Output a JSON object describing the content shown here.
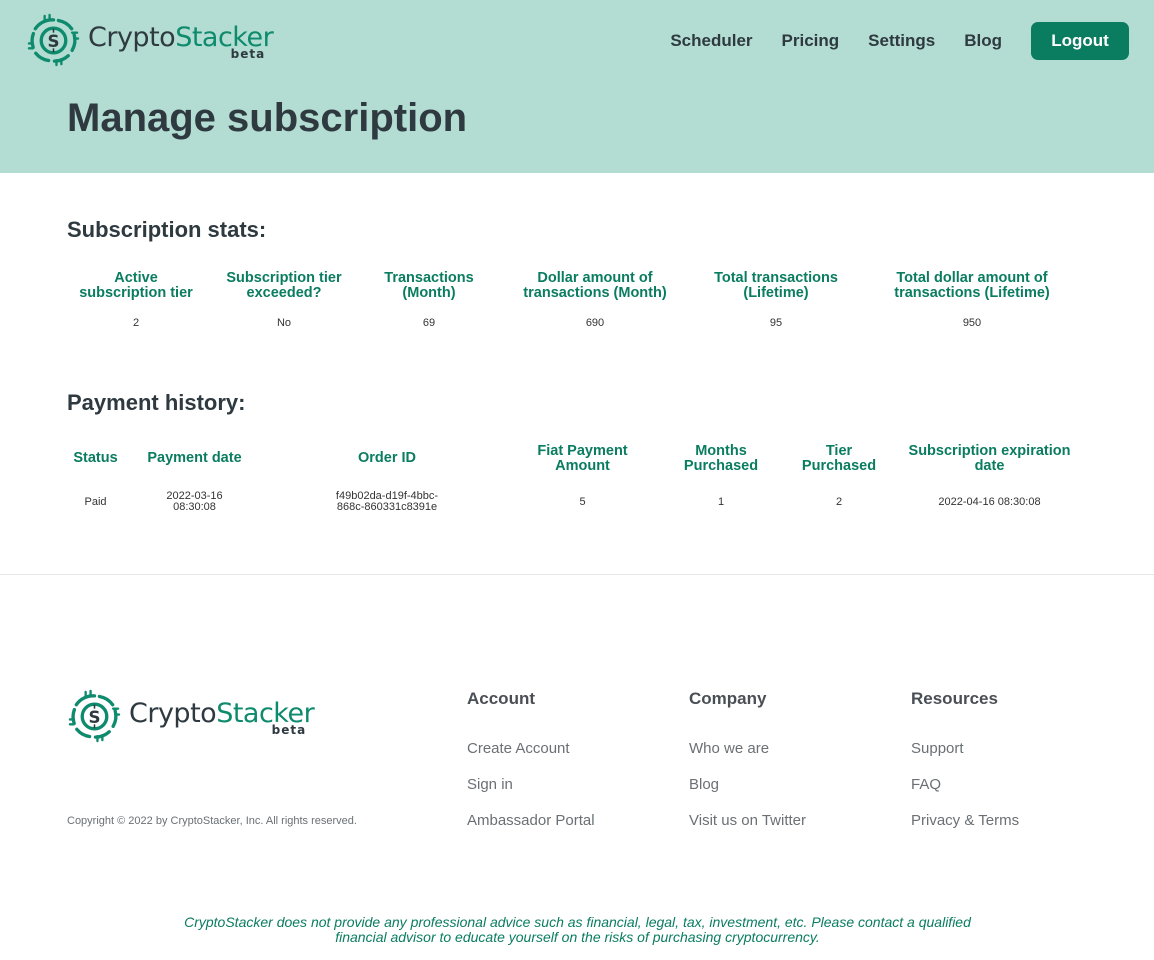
{
  "brand": {
    "name_part1": "Crypto",
    "name_part2": "Stacker",
    "badge": "beta",
    "logo_color": "#0e8a6d"
  },
  "nav": {
    "items": [
      "Scheduler",
      "Pricing",
      "Settings",
      "Blog"
    ],
    "logout_label": "Logout"
  },
  "page": {
    "title": "Manage subscription"
  },
  "stats": {
    "heading": "Subscription stats:",
    "columns": [
      [
        "Active",
        "subscription tier"
      ],
      [
        "Subscription tier",
        "exceeded?"
      ],
      [
        "Transactions",
        "(Month)"
      ],
      [
        "Dollar amount of",
        "transactions (Month)"
      ],
      [
        "Total transactions",
        "(Lifetime)"
      ],
      [
        "Total dollar amount of",
        "transactions (Lifetime)"
      ]
    ],
    "values": [
      "2",
      "No",
      "69",
      "690",
      "95",
      "950"
    ]
  },
  "payments": {
    "heading": "Payment history:",
    "columns": [
      [
        "Status"
      ],
      [
        "Payment date"
      ],
      [
        "Order ID"
      ],
      [
        "Fiat Payment",
        "Amount"
      ],
      [
        "Months",
        "Purchased"
      ],
      [
        "Tier",
        "Purchased"
      ],
      [
        "Subscription expiration",
        "date"
      ]
    ],
    "rows": [
      [
        [
          "Paid"
        ],
        [
          "2022-03-16",
          "08:30:08"
        ],
        [
          "f49b02da-d19f-4bbc-",
          "868c-860331c8391e"
        ],
        [
          "5"
        ],
        [
          "1"
        ],
        [
          "2"
        ],
        [
          "2022-04-16 08:30:08"
        ]
      ]
    ]
  },
  "footer": {
    "copyright": "Copyright © 2022 by CryptoStacker, Inc. All rights reserved.",
    "account": {
      "title": "Account",
      "links": [
        "Create Account",
        "Sign in",
        "Ambassador Portal"
      ]
    },
    "company": {
      "title": "Company",
      "links": [
        "Who we are",
        "Blog",
        "Visit us on Twitter"
      ]
    },
    "resources": {
      "title": "Resources",
      "links": [
        "Support",
        "FAQ",
        "Privacy & Terms"
      ]
    },
    "disclaimer": "CryptoStacker does not provide any professional advice such as financial, legal, tax, investment, etc. Please contact a qualified financial advisor to educate yourself on the risks of purchasing cryptocurrency."
  }
}
